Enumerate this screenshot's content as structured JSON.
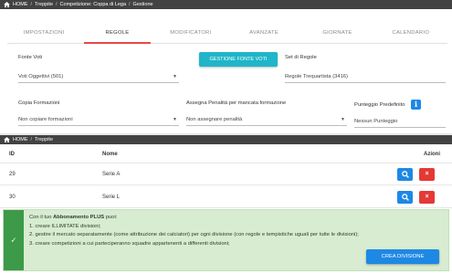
{
  "top_breadcrumb": [
    "HOME",
    "Treppite",
    "Competizione: Coppa di Lega",
    "Gestione"
  ],
  "tabs": [
    {
      "label": "IMPOSTAZIONI",
      "active": false
    },
    {
      "label": "REGOLE",
      "active": true
    },
    {
      "label": "MODIFICATORI",
      "active": false
    },
    {
      "label": "AVANZATE",
      "active": false
    },
    {
      "label": "GIORNATE",
      "active": false
    },
    {
      "label": "CALENDARIO",
      "active": false
    }
  ],
  "form": {
    "fonte_voti_label": "Fonte Voti",
    "fonte_voti_value": "Voti Oggettivi (501)",
    "gestione_button": "GESTIONE FONTE VOTI",
    "set_regole_label": "Set di Regole",
    "set_regole_value": "Regole Trequartista (3416)",
    "copia_label": "Copia Formazioni",
    "copia_value": "Non copiare formazioni",
    "penalita_label": "Assegna Penalità per mancata formazione",
    "penalita_value": "Non assegnare penalità",
    "punteggio_label": "Punteggio Predefinito",
    "punteggio_value": "Nessun Punteggio",
    "info_glyph": "i"
  },
  "second_breadcrumb": [
    "HOME",
    "Treppite"
  ],
  "table": {
    "headers": {
      "id": "ID",
      "nome": "Nome",
      "azioni": "Azioni"
    },
    "rows": [
      {
        "id": "29",
        "nome": "Serie A"
      },
      {
        "id": "30",
        "nome": "Serie L"
      }
    ],
    "search_icon": "search-icon",
    "delete_glyph": "×"
  },
  "alert": {
    "intro_prefix": "Con il tuo ",
    "intro_bold": "Abbonamento PLUS",
    "intro_suffix": " puoi:",
    "item1": "1. creare ILLIMITATE divisioni;",
    "item2": "2. gestire il mercato separatamente (come attribuzione dei calciatori) per ogni divisione (con regole e tempistiche uguali per tutte le divisioni);",
    "item3": "3. creare competizioni a cui parteciperanno squadre appartenenti a differenti divisioni;",
    "button": "CREA DIVISIONE",
    "check_glyph": "✓"
  },
  "colors": {
    "accent_red": "#e8484b",
    "teal": "#20b5c8",
    "blue": "#1e88e5",
    "danger": "#e53935",
    "success": "#3c9a49"
  }
}
